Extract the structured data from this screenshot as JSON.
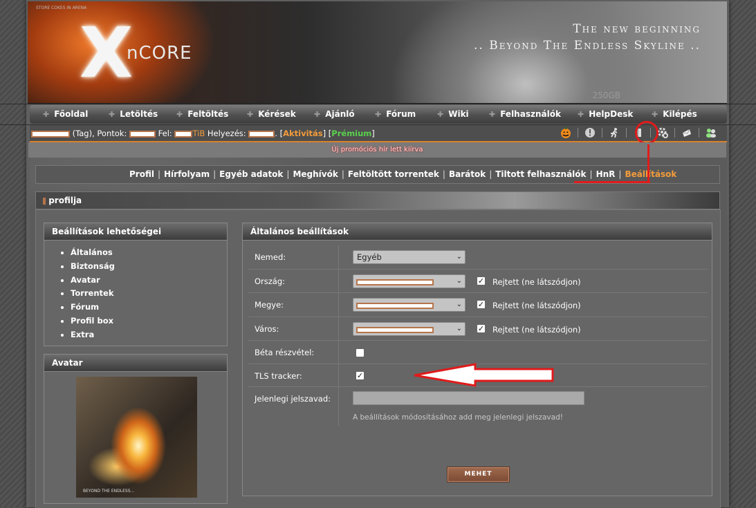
{
  "banner": {
    "small_text": "STORE COKES IN ARENA",
    "logo_x": "X",
    "logo_name": "nCORE",
    "slogan_line1": "The new beginning",
    "slogan_line2": ".. Beyond The Endless Skyline ..",
    "storage": "250GB"
  },
  "nav": {
    "items": [
      "Főoldal",
      "Letöltés",
      "Feltöltés",
      "Kérések",
      "Ajánló",
      "Fórum",
      "Wiki",
      "Felhasználók",
      "HelpDesk",
      "Kilépés"
    ]
  },
  "userbar": {
    "rank": "(Tag), Pontok:",
    "fel": "Fel:",
    "unit": "TiB",
    "placement": "Helyezés:",
    "activity": "Aktivitás",
    "premium": "Prémium",
    "icons": [
      "halloween-pumpkin-icon",
      "alert-icon",
      "running-person-icon",
      "bookmark-icon",
      "settings-gear-icon",
      "envelope-icon",
      "friends-icon"
    ]
  },
  "promo": {
    "text": "Új promóciós hír lett kiírva"
  },
  "subnav": {
    "items": [
      "Profil",
      "Hírfolyam",
      "Egyéb adatok",
      "Meghívók",
      "Feltöltött torrentek",
      "Barátok",
      "Tiltott felhasználók",
      "HnR"
    ],
    "active": "Beállítások"
  },
  "profile": {
    "suffix": "profilja"
  },
  "options": {
    "title": "Beállítások lehetőségei",
    "items": [
      "Általános",
      "Biztonság",
      "Avatar",
      "Torrentek",
      "Fórum",
      "Profil box",
      "Extra"
    ]
  },
  "avatar": {
    "title": "Avatar",
    "caption": "BEYOND THE ENDLESS..."
  },
  "settings": {
    "title": "Általános beállítások",
    "gender_label": "Nemed:",
    "gender_value": "Egyéb",
    "country_label": "Ország:",
    "county_label": "Megye:",
    "city_label": "Város:",
    "hidden_label": "Rejtett (ne látszódjon)",
    "beta_label": "Béta részvétel:",
    "tls_label": "TLS tracker:",
    "password_label": "Jelenlegi jelszavad:",
    "password_hint": "A beállítások módosításához add meg jelenlegi jelszavad!",
    "submit": "MEHET",
    "check_mark": "✓"
  }
}
